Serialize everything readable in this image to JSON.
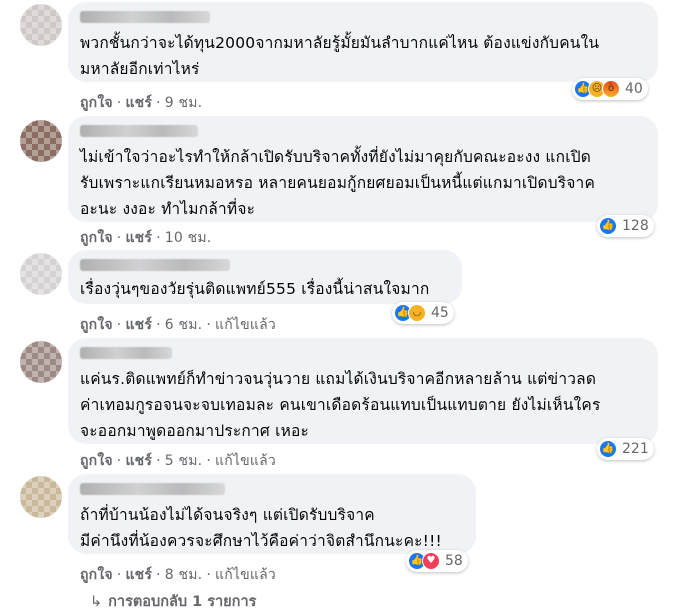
{
  "comments": [
    {
      "lines": [
        "พวกชั้นกว่าจะได้ทุน2000จากมหาลัยรู้มั้ยมันลำบากแค่ไหน ต้องแข่งกับคนใน",
        "มหาลัยอีกเท่าไหร่"
      ],
      "like_label": "ถูกใจ",
      "reply_label": "แชร์",
      "time": "9 ชม.",
      "reactions": [
        "like-icon",
        "sad-icon",
        "angry-icon"
      ],
      "reaction_count": "40"
    },
    {
      "lines": [
        "ไม่เข้าใจว่าอะไรทำให้กล้าเปิดรับบริจาคทั้งที่ยังไม่มาคุยกับคณะอะงง แกเปิด",
        "รับเพราะแกเรียนหมอหรอ หลายคนยอมกู้กยศยอมเป็นหนี้แต่แกมาเปิดบริจาค",
        "อะนะ งงอะ ทำไมกล้าที่จะ"
      ],
      "like_label": "ถูกใจ",
      "reply_label": "แชร์",
      "time": "10 ชม.",
      "reactions": [
        "like-icon"
      ],
      "reaction_count": "128"
    },
    {
      "lines": [
        "เรื่องวุ่นๆของวัยรุ่นติดแพทย์555 เรื่องนี้น่าสนใจมาก"
      ],
      "like_label": "ถูกใจ",
      "reply_label": "แชร์",
      "time": "6 ชม.",
      "edited": "แก้ไขแล้ว",
      "reactions": [
        "like-icon",
        "haha-icon"
      ],
      "reaction_count": "45"
    },
    {
      "lines": [
        "แค่นร.ติดแพทย์ก็ทำข่าวจนวุ่นวาย แถมได้เงินบริจาคอีกหลายล้าน แต่ข่าวลด",
        "ค่าเทอมกูรอจนจะจบเทอมละ คนเขาเดือดร้อนแทบเป็นแทบตาย ยังไม่เห็นใคร",
        "จะออกมาพูดออกมาประกาศ เหอะ"
      ],
      "like_label": "ถูกใจ",
      "reply_label": "แชร์",
      "time": "5 ชม.",
      "edited": "แก้ไขแล้ว",
      "reactions": [
        "like-icon"
      ],
      "reaction_count": "221"
    },
    {
      "lines": [
        "ถ้าที่บ้านน้องไม่ได้จนจริงๆ แต่เปิดรับบริจาค",
        "มีค่านึงที่น้องควรจะศึกษาไว้คือค่าว่าจิตสำนึกนะคะ!!!"
      ],
      "like_label": "ถูกใจ",
      "reply_label": "แชร์",
      "time": "8 ชม.",
      "edited": "แก้ไขแล้ว",
      "reactions": [
        "like-icon",
        "love-icon"
      ],
      "reaction_count": "58"
    }
  ],
  "replies_label": "การตอบกลับ 1 รายการ",
  "colors": {
    "bubble": "#f0f2f5",
    "meta": "#65676b",
    "like": "#1877f2",
    "love": "#f33e58"
  }
}
